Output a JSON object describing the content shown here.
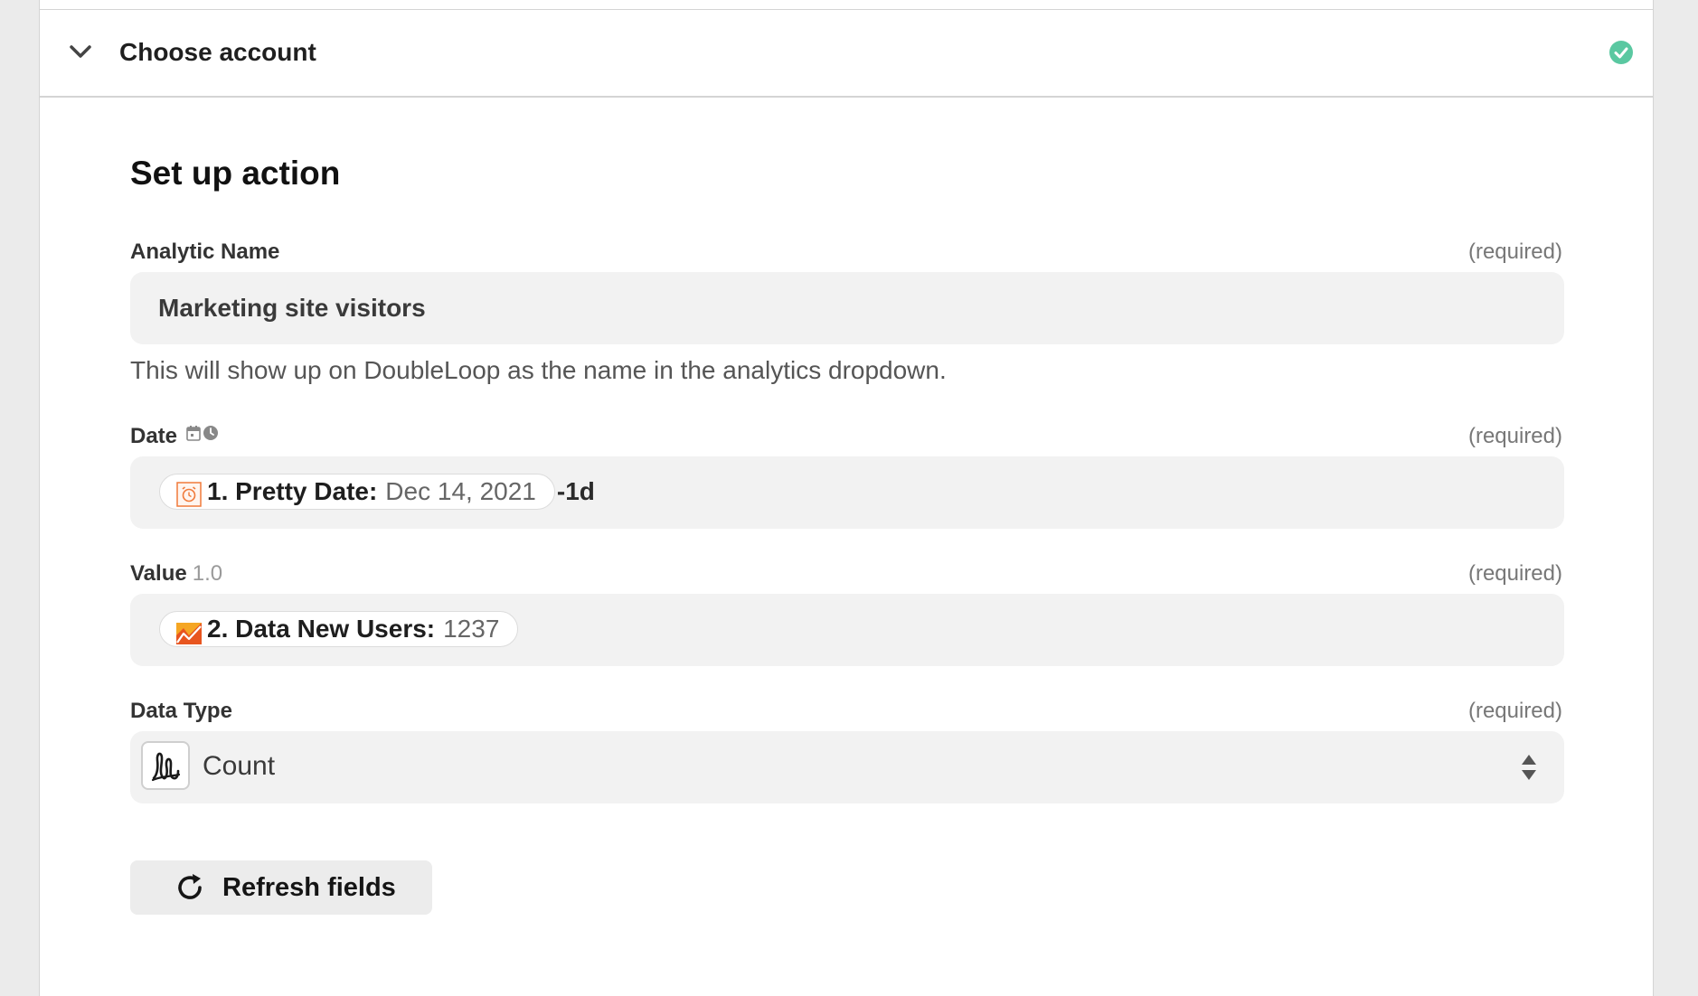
{
  "account_section": {
    "title": "Choose account",
    "status_icon": "check-circle-icon",
    "expand_icon": "chevron-down-icon"
  },
  "setup": {
    "title": "Set up action"
  },
  "fields": {
    "analytic_name": {
      "label": "Analytic Name",
      "required": "(required)",
      "value": "Marketing site visitors",
      "help": "This will show up on DoubleLoop as the name in the analytics dropdown."
    },
    "date": {
      "label": "Date",
      "required": "(required)",
      "label_icons": [
        "calendar-icon",
        "clock-icon"
      ],
      "pill_label": "1. Pretty Date:",
      "pill_value": "Dec 14, 2021",
      "suffix": "-1d",
      "pill_icon": "alarm-clock-icon"
    },
    "value": {
      "label": "Value",
      "hint": "1.0",
      "required": "(required)",
      "pill_label": "2. Data New Users:",
      "pill_value": "1237",
      "pill_icon": "analytics-chart-icon"
    },
    "data_type": {
      "label": "Data Type",
      "required": "(required)",
      "selected": "Count",
      "app_icon": "doubleloop-logo-icon",
      "select_icon": "sort-arrows-icon"
    }
  },
  "refresh_button": {
    "label": "Refresh fields",
    "icon": "refresh-icon"
  },
  "colors": {
    "success": "#5ac8a1",
    "field_bg": "#f2f2f2",
    "accent_orange": "#f07a3a"
  }
}
